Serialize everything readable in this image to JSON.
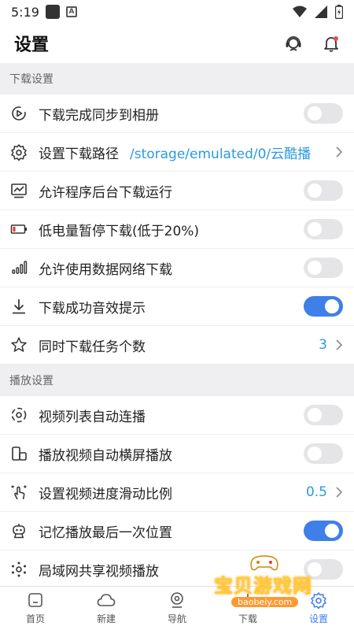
{
  "status_bar": {
    "time": "5:19",
    "a_icon": "A"
  },
  "header": {
    "title": "设置"
  },
  "sections": {
    "download": {
      "title": "下载设置",
      "items": [
        {
          "label": "下载完成同步到相册",
          "toggle": false
        },
        {
          "label": "设置下载路径",
          "value": "/storage/emulated/0/云酷播"
        },
        {
          "label": "允许程序后台下载运行",
          "toggle": false
        },
        {
          "label": "低电量暂停下载(低于20%)",
          "toggle": false
        },
        {
          "label": "允许使用数据网络下载",
          "toggle": false
        },
        {
          "label": "下载成功音效提示",
          "toggle": true
        },
        {
          "label": "同时下载任务个数",
          "value": "3"
        }
      ]
    },
    "playback": {
      "title": "播放设置",
      "items": [
        {
          "label": "视频列表自动连播",
          "toggle": false
        },
        {
          "label": "播放视频自动横屏播放",
          "toggle": false
        },
        {
          "label": "设置视频进度滑动比例",
          "value": "0.5"
        },
        {
          "label": "记忆播放最后一次位置",
          "toggle": true
        },
        {
          "label": "局域网共享视频播放",
          "toggle": false
        }
      ]
    }
  },
  "bottom_nav": {
    "items": [
      {
        "label": "首页",
        "icon": "home-icon"
      },
      {
        "label": "新建",
        "icon": "cloud-icon"
      },
      {
        "label": "导航",
        "icon": "compass-icon"
      },
      {
        "label": "下载",
        "icon": "download-icon"
      },
      {
        "label": "设置",
        "icon": "settings-icon",
        "active": true
      }
    ]
  },
  "watermark": {
    "text": "宝贝游戏网",
    "url": "baobeiy.com"
  },
  "colors": {
    "accent": "#3f7fe8",
    "value_blue": "#2a9adf",
    "section_bg": "#efeff1"
  }
}
